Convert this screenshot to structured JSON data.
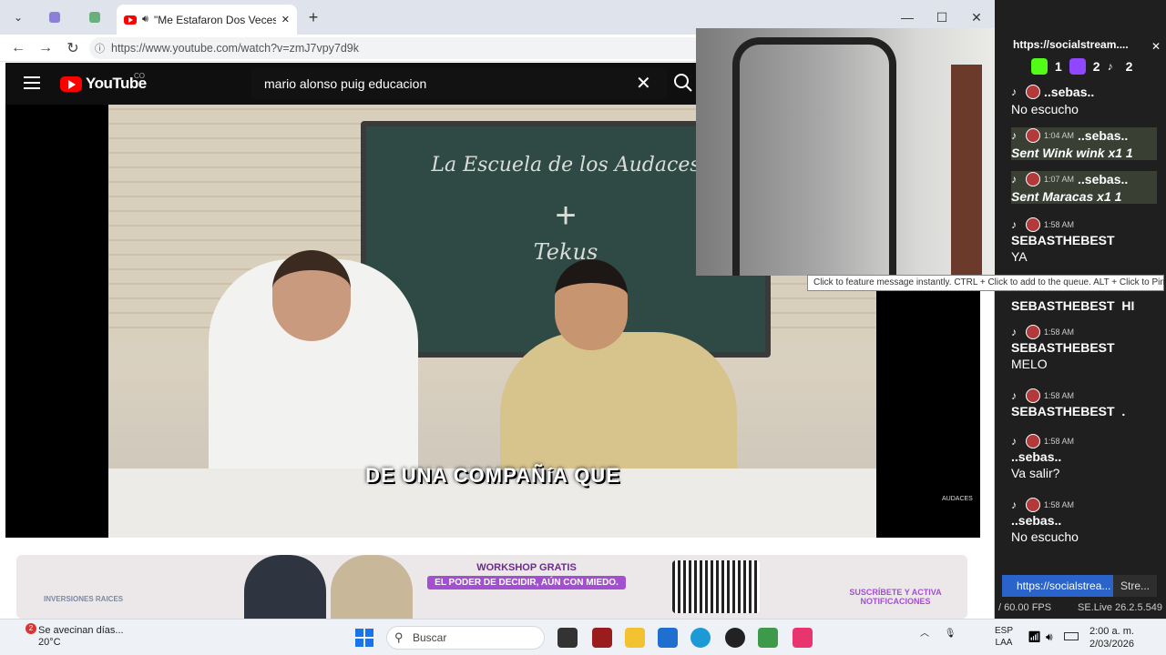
{
  "browser": {
    "tab_title": "\"Me Estafaron Dos Veces y ho",
    "url": "https://www.youtube.com/watch?v=zmJ7vpy7d9k",
    "controls": {
      "new_tab": "+",
      "minimize": "—",
      "maximize": "☐",
      "close": "✕",
      "tab_close": "✕"
    }
  },
  "youtube": {
    "logo_text": "YouTube",
    "country": "CO",
    "search_value": "mario alonso puig educacion",
    "clear_icon": "✕"
  },
  "video": {
    "whiteboard_line1": "La Escuela de los Audaces",
    "whiteboard_plus": "+",
    "whiteboard_line2": "Tekus",
    "caption": "DE UNA COMPAÑíA QUE",
    "watermark": "AUDACES"
  },
  "banner": {
    "brand": "INVERSIONES RAICES",
    "workshop_title": "WORKSHOP GRATIS",
    "workshop_tag": "EL PODER DE DECIDIR, AÚN CON MIEDO.",
    "subscribe": "SUSCRÍBETE Y ACTIVA NOTIFICACIONES"
  },
  "tooltip": "Click to feature message instantly. CTRL + Click to add to the queue. ALT + Click to Pin.",
  "chat": {
    "url": "https://socialstream....",
    "counts": [
      "1",
      "2",
      "2"
    ],
    "messages": [
      {
        "time": "",
        "name": "..sebas..",
        "text": "No escucho",
        "italic": false
      },
      {
        "time": "1:04 AM",
        "name": "..sebas..",
        "text": "Sent Wink wink x1",
        "italic": true,
        "count": "1"
      },
      {
        "time": "1:07 AM",
        "name": "..sebas..",
        "text": "Sent Maracas x1",
        "italic": true,
        "count": "1"
      },
      {
        "time": "1:58 AM",
        "name": "SEBASTHEBEST",
        "text": "YA",
        "italic": false
      },
      {
        "time": "",
        "name": "SEBASTHEBEST",
        "text": "HI",
        "italic": false
      },
      {
        "time": "1:58 AM",
        "name": "SEBASTHEBEST",
        "text": "MELO",
        "italic": false
      },
      {
        "time": "1:58 AM",
        "name": "SEBASTHEBEST",
        "text": ".",
        "italic": false
      },
      {
        "time": "1:58 AM",
        "name": "..sebas..",
        "text": "Va salir?",
        "italic": false
      },
      {
        "time": "1:58 AM",
        "name": "..sebas..",
        "text": "No escucho",
        "italic": false
      }
    ],
    "bottom_link": "https://socialstrea...",
    "bottom_tab": "Stre...",
    "fps": "/ 60.00 FPS",
    "version": "SE.Live 26.2.5.549"
  },
  "taskbar": {
    "weather_badge": "2",
    "weather_title": "Se avecinan días...",
    "weather_temp": "20°C",
    "search_placeholder": "Buscar",
    "lang1": "ESP",
    "lang2": "LAA",
    "time": "2:00 a. m.",
    "date": "2/03/2026"
  },
  "colors": {
    "youtube_red": "#ff0000",
    "chat_bg": "#1f1f1f",
    "accent_blue": "#2a63c9"
  }
}
